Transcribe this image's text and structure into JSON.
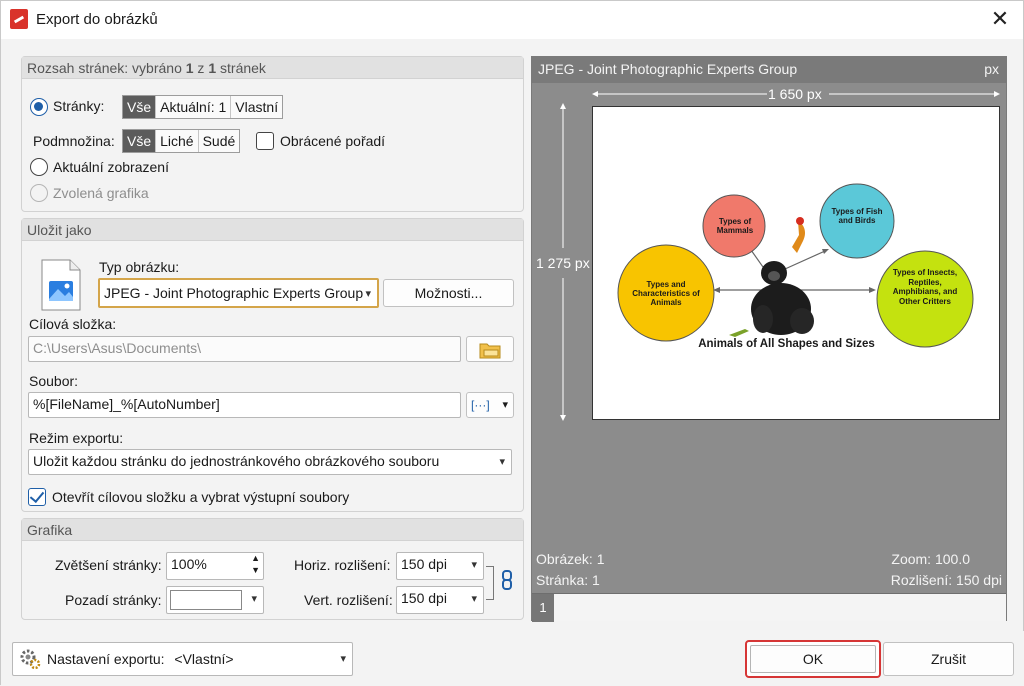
{
  "window": {
    "title": "Export do obrázků"
  },
  "range": {
    "header_prefix": "Rozsah stránek: vybráno ",
    "selected": "1",
    "of_word": " z ",
    "total": "1",
    "header_suffix": " stránek",
    "pages_label": "Stránky:",
    "page_options": [
      "Vše",
      "Aktuální: 1",
      "Vlastní"
    ],
    "subset_label": "Podmnožina:",
    "subset_options": [
      "Vše",
      "Liché",
      "Sudé"
    ],
    "reverse_label": "Obrácené pořadí",
    "current_view_label": "Aktuální zobrazení",
    "selected_graphic_label": "Zvolená grafika"
  },
  "save_as": {
    "header": "Uložit jako",
    "type_label": "Typ obrázku:",
    "type_value": "JPEG - Joint Photographic Experts Group",
    "options_button": "Možnosti...",
    "folder_label": "Cílová složka:",
    "folder_value": "C:\\Users\\Asus\\Documents\\",
    "file_label": "Soubor:",
    "file_value": "%[FileName]_%[AutoNumber]",
    "macro_button": "[···]",
    "mode_label": "Režim exportu:",
    "mode_value": "Uložit každou stránku do jednostránkového obrázkového souboru",
    "open_folder_label": "Otevřít cílovou složku a vybrat výstupní soubory"
  },
  "graphics": {
    "header": "Grafika",
    "zoom_label": "Zvětšení stránky:",
    "zoom_value": "100%",
    "background_label": "Pozadí stránky:",
    "hres_label": "Horiz. rozlišení:",
    "hres_value": "150 dpi",
    "vres_label": "Vert. rozlišení:",
    "vres_value": "150 dpi"
  },
  "preview": {
    "format": "JPEG - Joint Photographic Experts Group",
    "unit": "px",
    "width": "1 650 px",
    "height": "1 275 px",
    "image_label": "Obrázek: 1",
    "page_label": "Stránka: 1",
    "zoom_label": "Zoom: 100.0",
    "resolution_label": "Rozlišení: 150 dpi",
    "page_tab": "1",
    "diagram": {
      "title": "Animals of All Shapes and Sizes",
      "nodes": {
        "mammals": "Types of Mammals",
        "fish": "Types of Fish and Birds",
        "characteristics": "Types and Characteristics of Animals",
        "insects": "Types of Insects, Reptiles, Amphibians, and Other Critters"
      },
      "colors": {
        "mammals": "#f0796b",
        "fish": "#5bc8d8",
        "characteristics": "#f8c400",
        "insects": "#c4e20f"
      }
    }
  },
  "footer": {
    "settings_label": "Nastavení exportu:",
    "settings_value": "<Vlastní>",
    "ok": "OK",
    "cancel": "Zrušit"
  }
}
